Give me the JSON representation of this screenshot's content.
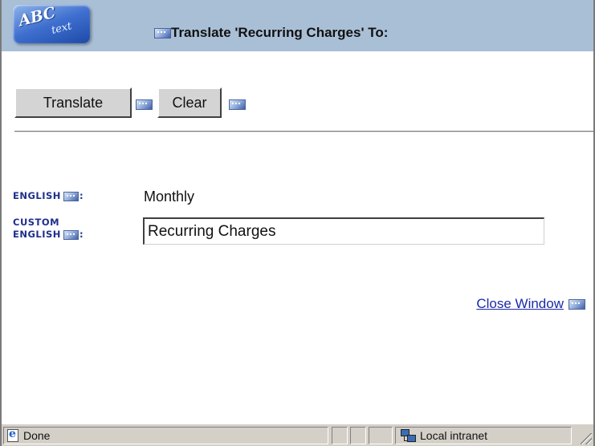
{
  "header": {
    "logo_text": "ABC",
    "logo_subtext": "text",
    "title": "Translate 'Recurring Charges' To:"
  },
  "toolbar": {
    "translate_label": "Translate",
    "clear_label": "Clear"
  },
  "form": {
    "english_label": "ENGLISH",
    "english_value": "Monthly",
    "custom_label_line1": "CUSTOM",
    "custom_label_line2": "ENGLISH",
    "label_suffix": ":",
    "custom_value": "Recurring Charges"
  },
  "links": {
    "close_window": "Close Window"
  },
  "statusbar": {
    "status_text": "Done",
    "zone_text": "Local intranet"
  },
  "icons": {
    "logo": "abc-text-logo-icon",
    "translate_glyph": "translate-glyph-icon",
    "browser": "ie-page-icon",
    "zone": "local-intranet-icon",
    "grip": "resize-grip-icon"
  },
  "colors": {
    "header_bg": "#a9bfd6",
    "label_color": "#1f2f8c",
    "link_color": "#1a2aa8",
    "chrome_bg": "#d4d0c8"
  }
}
